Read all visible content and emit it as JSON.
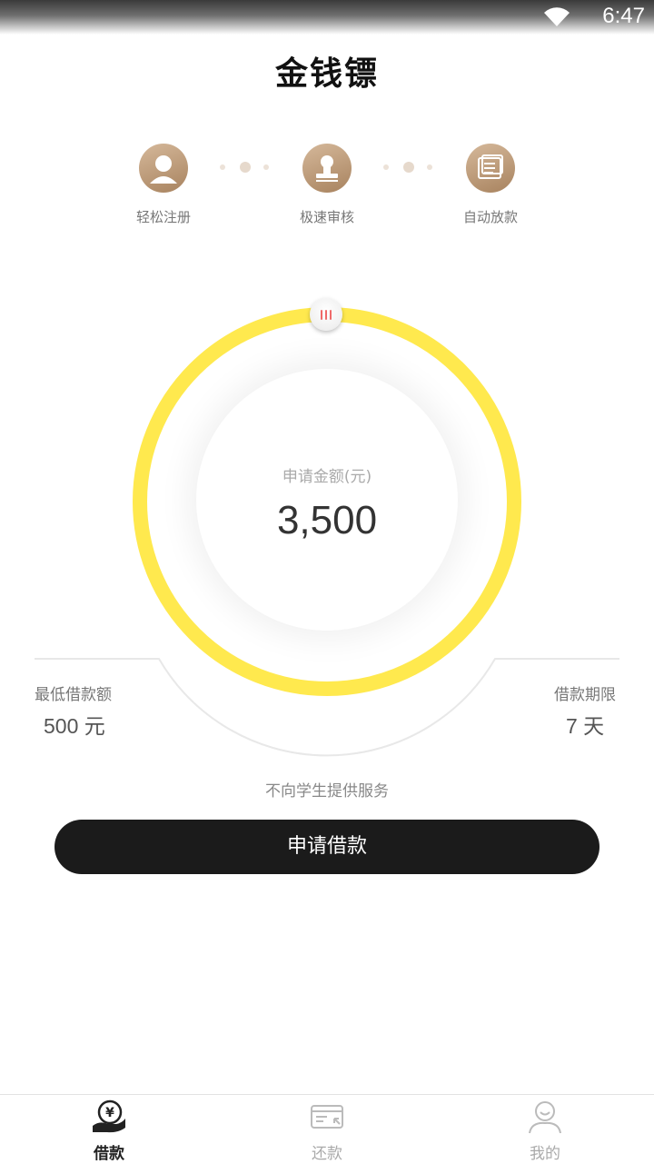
{
  "status_bar": {
    "time": "6:47",
    "wifi_icon": "wifi-icon"
  },
  "app": {
    "title": "金钱镖"
  },
  "steps": [
    {
      "label": "轻松注册",
      "icon": "user-icon"
    },
    {
      "label": "极速审核",
      "icon": "stamp-icon"
    },
    {
      "label": "自动放款",
      "icon": "money-stack-icon"
    }
  ],
  "loan": {
    "amount_label": "申请金额(元)",
    "amount_value": "3,500",
    "min_label": "最低借款额",
    "min_value": "500 元",
    "term_label": "借款期限",
    "term_value": "7 天",
    "notice": "不向学生提供服务",
    "apply_button": "申请借款"
  },
  "colors": {
    "ring": "#ffe94e",
    "button": "#1b1b1b",
    "step_gold": "#b8926c",
    "knob_mark": "#ef6a6a"
  },
  "tabbar": {
    "tabs": [
      {
        "label": "借款",
        "icon": "loan-yen-icon",
        "active": true
      },
      {
        "label": "还款",
        "icon": "repay-card-icon",
        "active": false
      },
      {
        "label": "我的",
        "icon": "profile-icon",
        "active": false
      }
    ]
  }
}
